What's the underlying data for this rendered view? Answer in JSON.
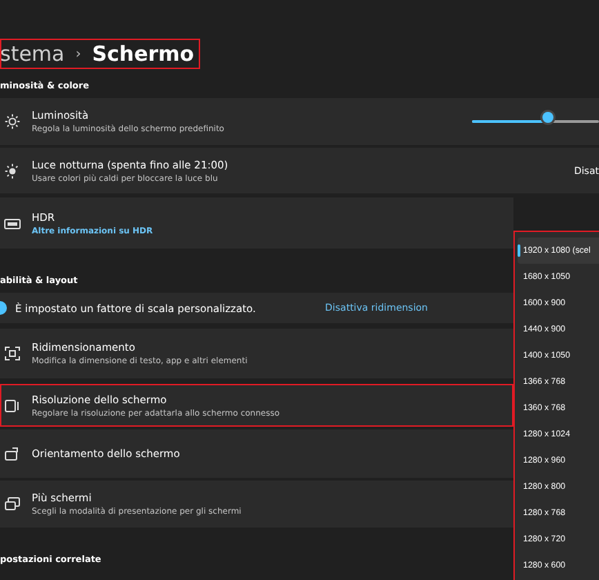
{
  "header": {
    "title_parent": "stema",
    "separator": "›",
    "title": "Schermo",
    "highlighted": true
  },
  "sections": [
    {
      "label": "minosità & colore",
      "rows": [
        {
          "kind": "slider",
          "title": "Luminosità",
          "subtitle": "Regola la luminosità dello schermo predefinito",
          "level": 0.6,
          "highlighted": false
        },
        {
          "kind": "action",
          "title": "Luce notturna (spenta fino alle 21:00)",
          "subtitle": "Usare colori più caldi per bloccare la luce blu",
          "action": "Disat",
          "highlighted": false
        },
        {
          "kind": "link",
          "title": "HDR",
          "link": "Altre informazioni su HDR",
          "highlighted": false
        }
      ]
    },
    {
      "label": "abilità & layout",
      "rows": [
        {
          "kind": "info",
          "title": "È impostato un fattore di scala personalizzato.",
          "action": "Disattiva ridimension",
          "highlighted": false
        },
        {
          "kind": "nav",
          "title": "Ridimensionamento",
          "subtitle": "Modifica la dimensione di testo, app e altri elementi",
          "highlighted": false
        },
        {
          "kind": "nav",
          "title": "Risoluzione dello schermo",
          "subtitle": "Regolare la risoluzione per adattarla allo schermo connesso",
          "highlighted": true
        },
        {
          "kind": "nav",
          "title": "Orientamento dello schermo",
          "highlighted": false
        },
        {
          "kind": "nav",
          "title": "Più schermi",
          "subtitle": "Scegli la modalità di presentazione per gli schermi",
          "highlighted": false
        }
      ]
    },
    {
      "label": "postazioni correlate"
    }
  ],
  "dropdown": {
    "highlighted": true,
    "options": [
      {
        "label": "1920 x 1080 (scel",
        "selected": true
      },
      {
        "label": "1680 x 1050",
        "selected": false
      },
      {
        "label": "1600 x 900",
        "selected": false
      },
      {
        "label": "1440 x 900",
        "selected": false
      },
      {
        "label": "1400 x 1050",
        "selected": false
      },
      {
        "label": "1366 x 768",
        "selected": false
      },
      {
        "label": "1360 x 768",
        "selected": false
      },
      {
        "label": "1280 x 1024",
        "selected": false
      },
      {
        "label": "1280 x 960",
        "selected": false
      },
      {
        "label": "1280 x 800",
        "selected": false
      },
      {
        "label": "1280 x 768",
        "selected": false
      },
      {
        "label": "1280 x 720",
        "selected": false
      },
      {
        "label": "1280 x 600",
        "selected": false
      }
    ]
  }
}
